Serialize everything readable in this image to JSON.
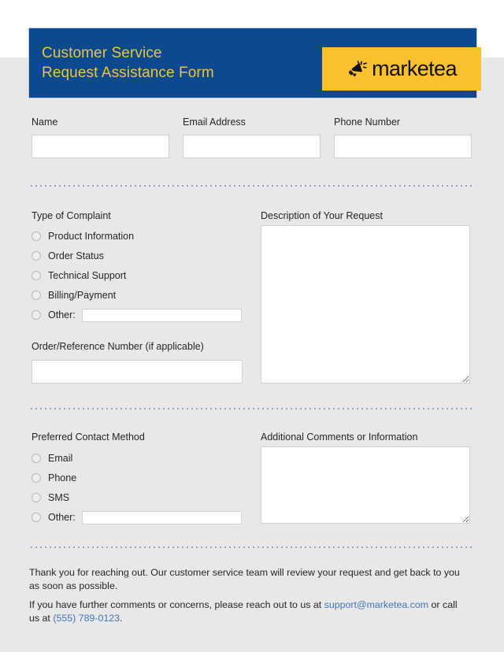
{
  "colors": {
    "header_blue": "#0b4a8f",
    "accent_yellow": "#fbc02d",
    "title_gold": "#eac43c",
    "page_grey": "#e8e8e8",
    "link_blue": "#3d76ba"
  },
  "header": {
    "title": "Customer Service\nRequest Assistance Form",
    "logo": {
      "icon": "megaphone-icon",
      "word": "marketea"
    }
  },
  "contact_section": {
    "fields": [
      {
        "label": "Name",
        "value": "",
        "placeholder": ""
      },
      {
        "label": "Email Address",
        "value": "",
        "placeholder": ""
      },
      {
        "label": "Phone Number",
        "value": "",
        "placeholder": ""
      }
    ]
  },
  "complaint_section": {
    "legend": "Type of Complaint",
    "options": [
      {
        "label": "Product Information",
        "selected": false
      },
      {
        "label": "Order Status",
        "selected": false
      },
      {
        "label": "Technical Support",
        "selected": false
      },
      {
        "label": "Billing/Payment",
        "selected": false
      },
      {
        "label": "Other:",
        "selected": false,
        "has_input": true,
        "value": ""
      }
    ],
    "order_number": {
      "label": "Order/Reference Number (if applicable)",
      "value": "",
      "placeholder": ""
    },
    "description": {
      "label": "Description of Your Request",
      "value": "",
      "placeholder": ""
    }
  },
  "contact_method_section": {
    "legend": "Preferred Contact Method",
    "options": [
      {
        "label": "Email",
        "selected": false
      },
      {
        "label": "Phone",
        "selected": false
      },
      {
        "label": "SMS",
        "selected": false
      },
      {
        "label": "Other:",
        "selected": false,
        "has_input": true,
        "value": ""
      }
    ],
    "additional_comments": {
      "label": "Additional Comments or Information",
      "value": "",
      "placeholder": ""
    }
  },
  "footer": {
    "paragraph_1": "Thank you for reaching out. Our customer service team will review your request and get back to you as soon as possible.",
    "paragraph_2_prefix": "If you have further comments or concerns, please reach out to us at ",
    "email": "support@marketea.com",
    "paragraph_2_middle": " or call us at ",
    "phone": "(555) 789-0123",
    "paragraph_2_suffix": "."
  }
}
